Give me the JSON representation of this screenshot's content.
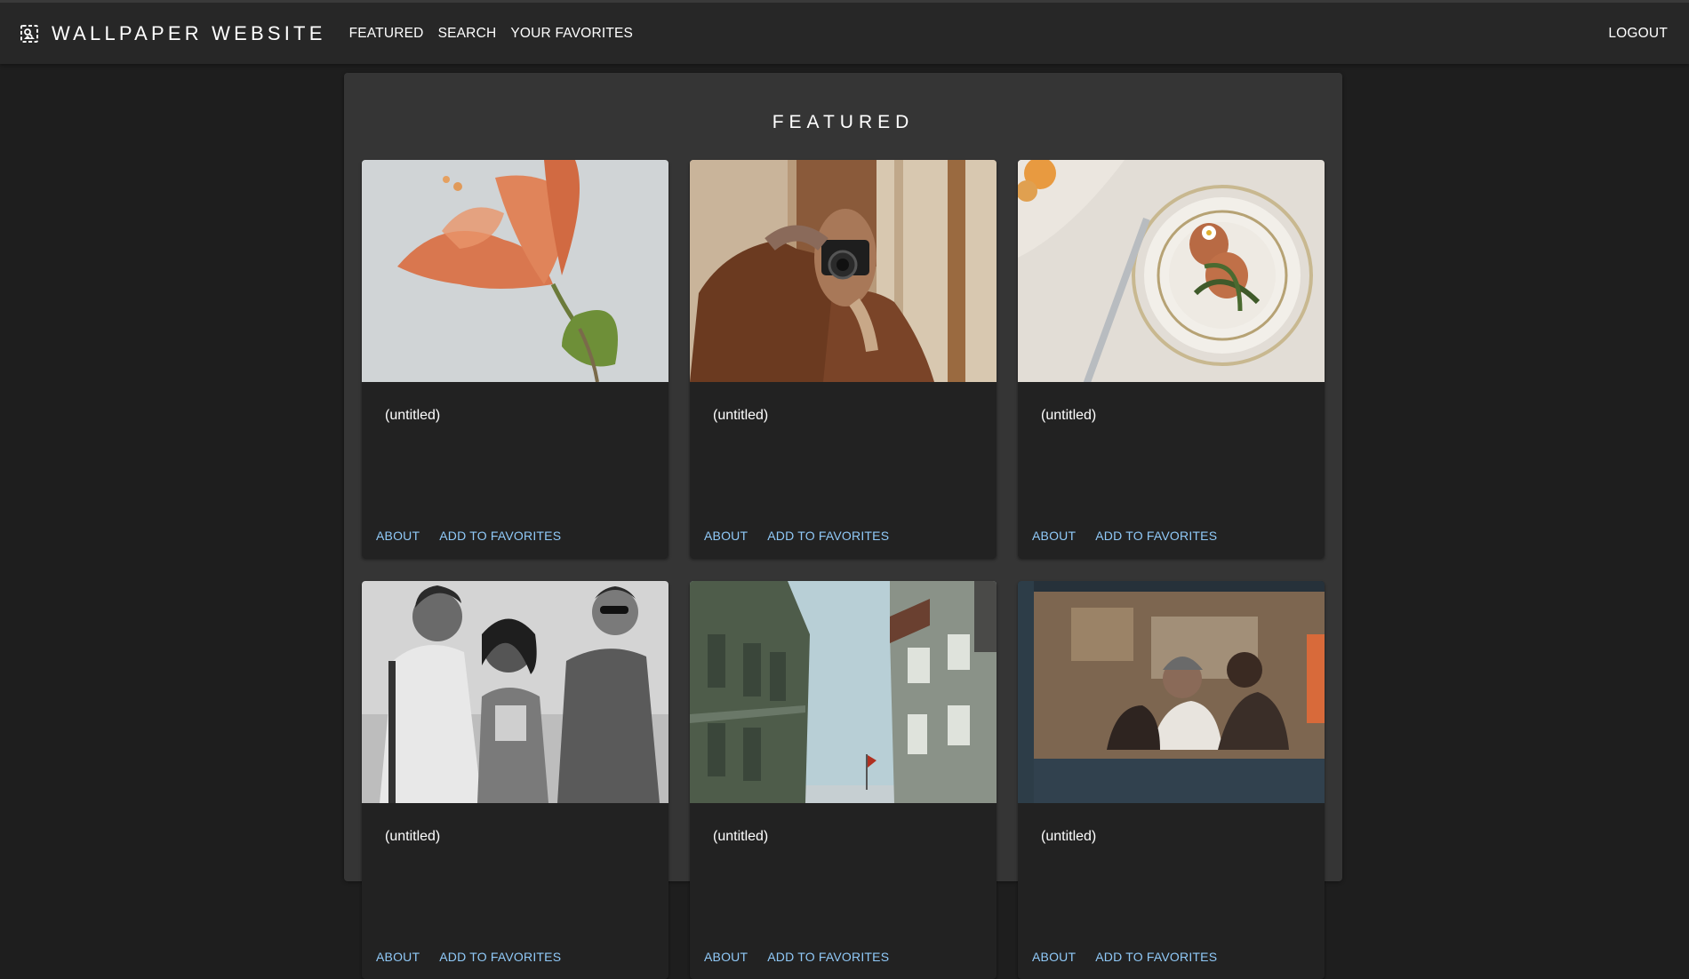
{
  "appbar": {
    "brand_icon": "image-search-icon",
    "title": "WALLPAPER WEBSITE",
    "nav": [
      "FEATURED",
      "SEARCH",
      "YOUR FAVORITES"
    ],
    "logout": "LOGOUT"
  },
  "featured": {
    "heading": "FEATURED",
    "cards": [
      {
        "title": "(untitled)",
        "about": "ABOUT",
        "favorite": "ADD TO FAVORITES"
      },
      {
        "title": "(untitled)",
        "about": "ABOUT",
        "favorite": "ADD TO FAVORITES"
      },
      {
        "title": "(untitled)",
        "about": "ABOUT",
        "favorite": "ADD TO FAVORITES"
      },
      {
        "title": "(untitled)",
        "about": "ABOUT",
        "favorite": "ADD TO FAVORITES"
      },
      {
        "title": "(untitled)",
        "about": "ABOUT",
        "favorite": "ADD TO FAVORITES"
      },
      {
        "title": "(untitled)",
        "about": "ABOUT",
        "favorite": "ADD TO FAVORITES"
      }
    ]
  },
  "colors": {
    "background": "#1e1e1e",
    "appbar": "#272727",
    "panel": "#353535",
    "card": "#222222",
    "link": "#90caf9"
  }
}
